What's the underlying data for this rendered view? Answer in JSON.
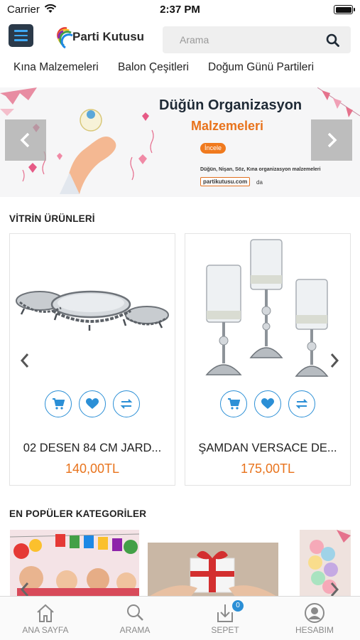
{
  "status_bar": {
    "carrier": "Carrier",
    "time": "2:37 PM"
  },
  "header": {
    "logo_text": "Parti Kutusu",
    "search_placeholder": "Arama"
  },
  "categories": [
    "Kına Malzemeleri",
    "Balon Çeşitleri",
    "Doğum Günü Partileri"
  ],
  "banner": {
    "title": "Düğün Organizasyon",
    "subtitle": "Malzemeleri",
    "button": "İncele",
    "description": "Düğün, Nişan, Söz, Kına organizasyon malzemeleri",
    "url": "partikutusu.com",
    "url_suffix": "da"
  },
  "showcase": {
    "title": "VİTRİN ÜRÜNLERİ",
    "products": [
      {
        "name": "02 DESEN 84 CM JARD...",
        "price": "140,00TL"
      },
      {
        "name": "ŞAMDAN VERSACE DE...",
        "price": "175,00TL"
      }
    ]
  },
  "popular": {
    "title": "EN POPÜLER KATEGORİLER"
  },
  "tabbar": {
    "items": [
      {
        "label": "ANA SAYFA",
        "icon": "home-icon"
      },
      {
        "label": "ARAMA",
        "icon": "search-icon"
      },
      {
        "label": "SEPET",
        "icon": "cart-download-icon"
      },
      {
        "label": "HESABIM",
        "icon": "account-icon"
      }
    ],
    "cart_badge": "0"
  },
  "colors": {
    "accent_blue": "#2b8fd6",
    "price_orange": "#e8731c",
    "menu_bg": "#2b3a4a"
  }
}
